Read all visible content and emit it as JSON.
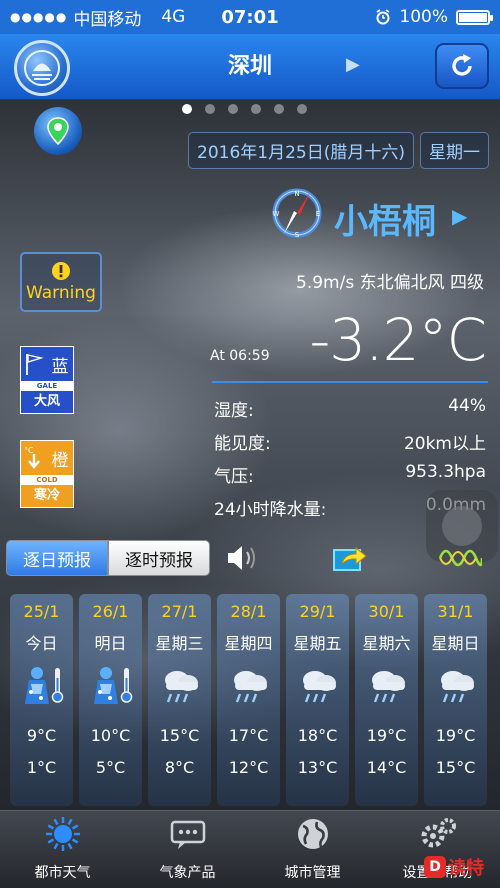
{
  "status_bar": {
    "signal": "●●●●●",
    "carrier": "中国移动",
    "network": "4G",
    "time": "07:01",
    "battery": "100%",
    "battery_level": 1.0
  },
  "nav": {
    "city": "深圳"
  },
  "pager": {
    "count": 6,
    "active": 0
  },
  "date": {
    "date": "2016年1月25日(腊月十六)",
    "weekday": "星期一"
  },
  "station": {
    "name": "小梧桐"
  },
  "current": {
    "wind": "5.9m/s 东北偏北风 四级",
    "temperature": "-3.2°C",
    "at_time": "At 06:59"
  },
  "details": [
    {
      "label": "湿度:",
      "value": "44%"
    },
    {
      "label": "能见度:",
      "value": "20km以上"
    },
    {
      "label": "气压:",
      "value": "953.3hpa"
    },
    {
      "label": "24小时降水量:",
      "value": "0.0mm"
    }
  ],
  "warnings": {
    "label": "Warning",
    "gale": {
      "level": "蓝",
      "en": "GALE",
      "cn": "大风"
    },
    "cold": {
      "level": "橙",
      "en": "COLD",
      "cn": "寒冷",
      "unit": "°C"
    }
  },
  "tabs": {
    "daily": "逐日预报",
    "hourly": "逐时预报"
  },
  "forecast": [
    {
      "date": "25/1",
      "weekday": "今日",
      "icon": "snow-person-icon",
      "high": "9°C",
      "low": "1°C"
    },
    {
      "date": "26/1",
      "weekday": "明日",
      "icon": "snow-person-icon",
      "high": "10°C",
      "low": "5°C"
    },
    {
      "date": "27/1",
      "weekday": "星期三",
      "icon": "rain-cloud-icon",
      "high": "15°C",
      "low": "8°C"
    },
    {
      "date": "28/1",
      "weekday": "星期四",
      "icon": "rain-cloud-icon",
      "high": "17°C",
      "low": "12°C"
    },
    {
      "date": "29/1",
      "weekday": "星期五",
      "icon": "rain-cloud-icon",
      "high": "18°C",
      "low": "13°C"
    },
    {
      "date": "30/1",
      "weekday": "星期六",
      "icon": "rain-cloud-icon",
      "high": "19°C",
      "low": "14°C"
    },
    {
      "date": "31/1",
      "weekday": "星期日",
      "icon": "rain-cloud-icon",
      "high": "19°C",
      "low": "15°C"
    }
  ],
  "tabbar": [
    {
      "label": "都市天气",
      "icon": "sun-icon"
    },
    {
      "label": "气象产品",
      "icon": "message-icon"
    },
    {
      "label": "城市管理",
      "icon": "globe-icon"
    },
    {
      "label": "设置与帮助",
      "icon": "gears-icon"
    }
  ],
  "watermark": {
    "text": "读特",
    "mark": "D"
  },
  "colors": {
    "accent_blue": "#1f6fd6",
    "station_blue": "#5ab8ff",
    "warning_yellow": "#ffd21f"
  }
}
